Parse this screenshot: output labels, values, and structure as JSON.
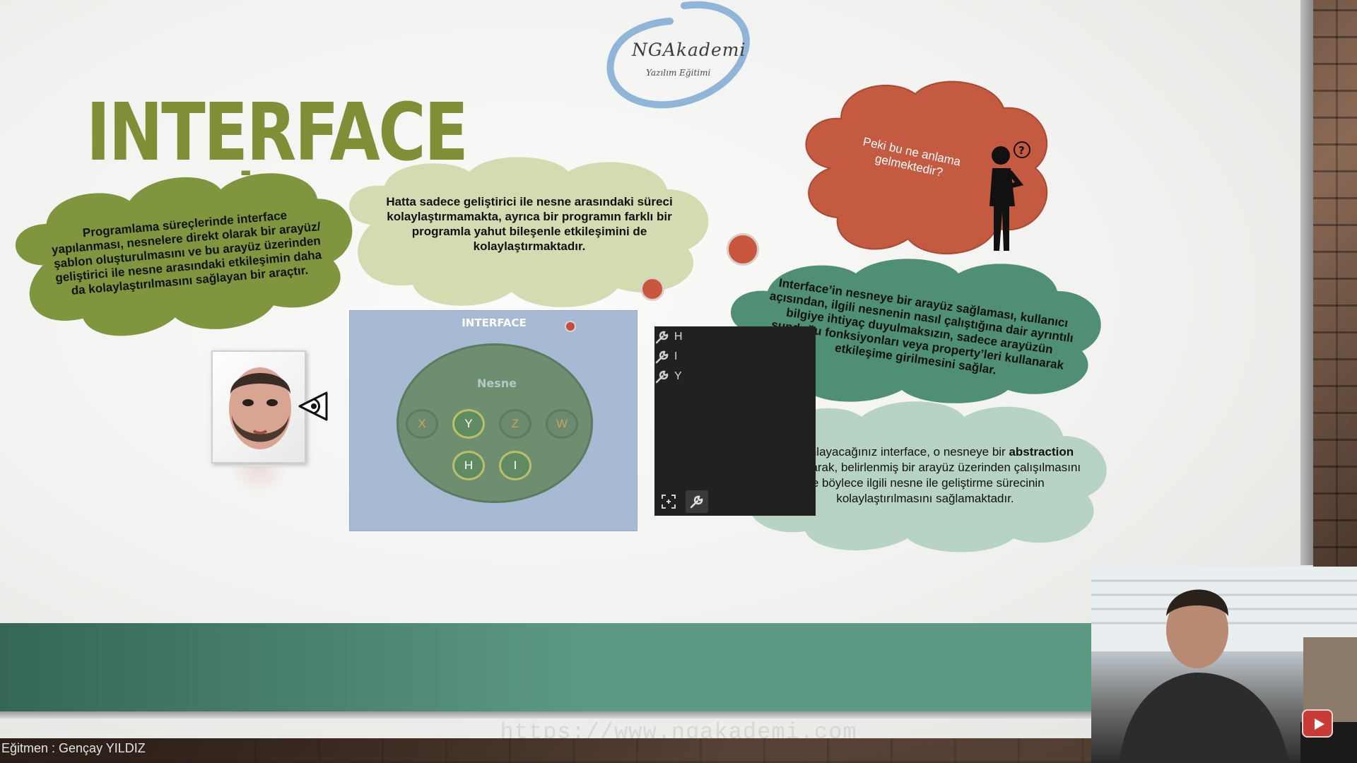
{
  "slide": {
    "title": "INTERFACE NEDİR?",
    "logo": {
      "name": "NGAkademi",
      "subtitle": "Yazılım Eğitimi"
    },
    "clouds": {
      "olive": "Programlama süreçlerinde interface yapılanması, nesnelere direkt olarak bir arayüz/şablon oluşturulmasını ve bu arayüz üzerinden geliştirici ile nesne arasındaki etkileşimin daha da kolaylaştırılmasını sağlayan bir araçtır.",
      "light": "Hatta sadece geliştirici ile nesne arasındaki süreci kolaylaştırmamakta, ayrıca bir programın farklı bir programla yahut bileşenle etkileşimini de kolaylaştırmaktadır.",
      "red": "Peki bu ne anlama gelmektedir?",
      "green": "Interface’in nesneye bir arayüz sağlaması, kullanıcı açısından, ilgili nesnenin nasıl çalıştığına dair ayrıntılı bilgiye ihtiyaç duyulmaksızın, sadece arayüzün sunduğu fonksiyonları veya property’leri kullanarak etkileşime girilmesini sağlar.",
      "pale_before": "Yani anlayacağınız interface, o nesneye bir",
      "pale_bold": "abstraction",
      "pale_after": "uygulayarak, belirlenmiş bir arayüz üzerinden çalışılmasını ve böylece ilgili nesne ile geliştirme sürecinin kolaylaştırılmasını sağlamaktadır."
    },
    "diagram": {
      "title": "INTERFACE",
      "object_label": "Nesne",
      "members_top": [
        "X",
        "Y",
        "Z",
        "W"
      ],
      "members_bottom": [
        "H",
        "I"
      ]
    },
    "tool_panel": {
      "items": [
        "H",
        "I",
        "Y"
      ]
    },
    "watermark": "https://www.ngakademi.com"
  },
  "footer": {
    "instructor": "Eğitmen : Gençay YILDIZ"
  },
  "colors": {
    "title": "#7f8f36",
    "olive_cloud": "#7f963f",
    "light_cloud": "#d3dcb0",
    "red_cloud": "#c45a40",
    "green_cloud": "#4f8f74",
    "pale_cloud": "#b6d3c4",
    "band": "#5c9a83"
  }
}
